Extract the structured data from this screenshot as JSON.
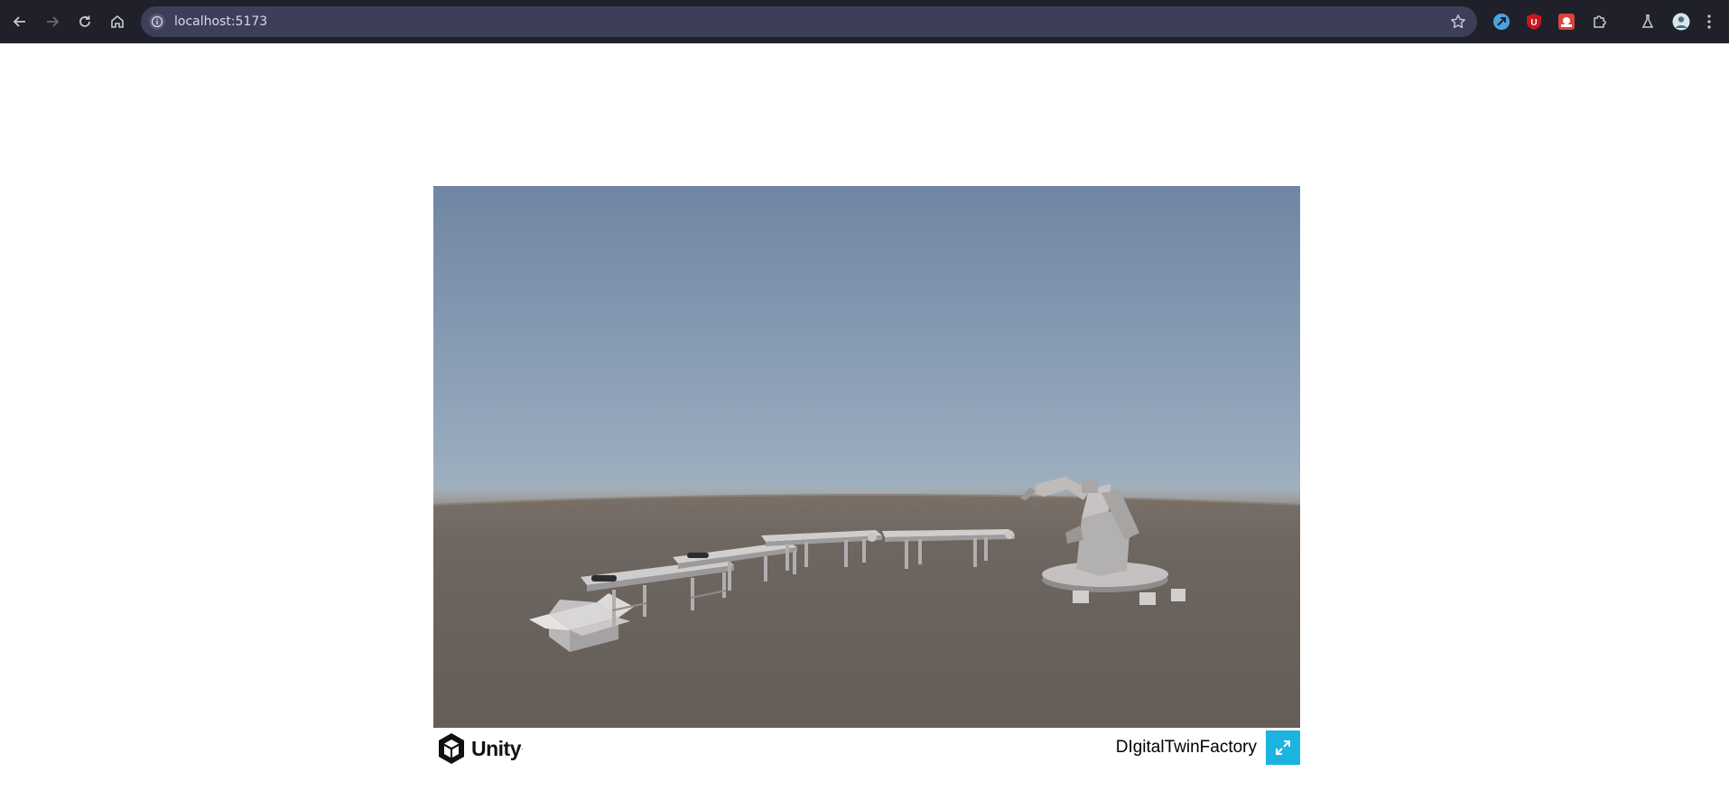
{
  "browser": {
    "url": "localhost:5173",
    "icons": [
      "back-arrow-icon",
      "forward-arrow-icon",
      "reload-icon",
      "home-icon",
      "site-info-icon",
      "bookmark-star-icon",
      "extension-1-icon",
      "ublock-icon",
      "extension-3-icon",
      "extensions-puzzle-icon",
      "labs-flask-icon",
      "profile-avatar-icon",
      "menu-kebab-icon"
    ]
  },
  "unity": {
    "logo_text": "Unity",
    "build_title": "DIgitalTwinFactory",
    "accent_color": "#1bb4e0",
    "sky_top_color": "#6f86a4",
    "horizon_color": "#c4cccc",
    "ground_color": "#6b635d"
  }
}
